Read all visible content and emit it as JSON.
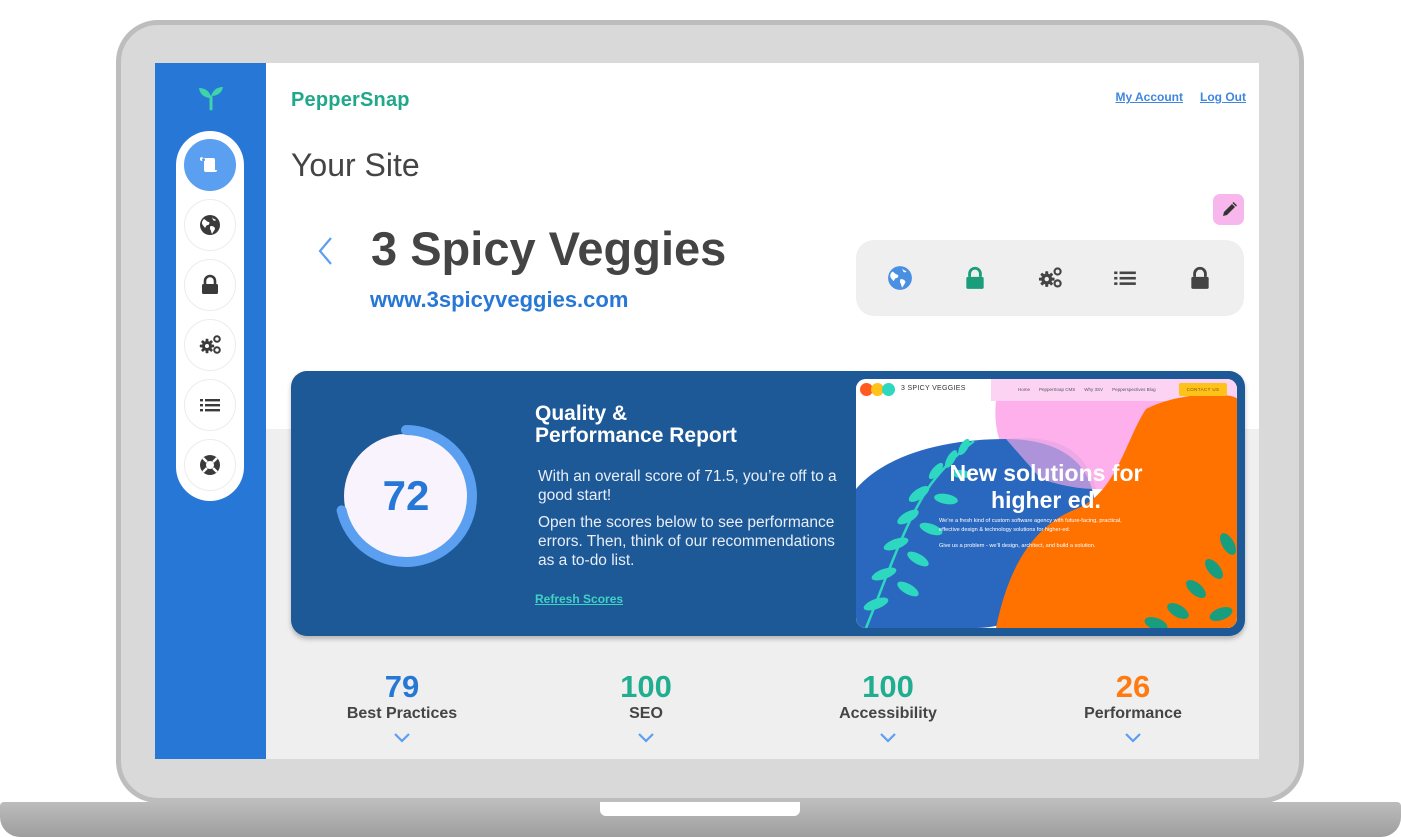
{
  "app": {
    "brand": "PepperSnap",
    "page_title": "Your Site"
  },
  "header": {
    "links": [
      {
        "label": "My Account"
      },
      {
        "label": "Log Out"
      }
    ]
  },
  "sidebar": {
    "logo_icon": "sprout-icon",
    "items": [
      {
        "name": "sites",
        "icon": "scroll-icon",
        "active": true
      },
      {
        "name": "domains",
        "icon": "globe-icon",
        "active": false
      },
      {
        "name": "security",
        "icon": "lock-icon",
        "active": false
      },
      {
        "name": "settings",
        "icon": "gears-icon",
        "active": false
      },
      {
        "name": "list",
        "icon": "list-icon",
        "active": false
      },
      {
        "name": "support",
        "icon": "lifebuoy-icon",
        "active": false
      }
    ]
  },
  "site": {
    "name": "3 Spicy Veggies",
    "url": "www.3spicyveggies.com",
    "status_icons": [
      {
        "icon": "globe-icon",
        "color": "#4a90e2"
      },
      {
        "icon": "lock-icon",
        "color": "#1a9e7a"
      },
      {
        "icon": "gears-icon",
        "color": "#444444"
      },
      {
        "icon": "list-icon",
        "color": "#444444"
      },
      {
        "icon": "lock-icon",
        "color": "#444444"
      }
    ]
  },
  "report": {
    "title_line1": "Quality &",
    "title_line2": "Performance Report",
    "score_display": "72",
    "score_value": 71.5,
    "score_max": 100,
    "paragraph1": "With an overall score of 71.5, you’re off to a good start!",
    "paragraph2": "Open the scores below to see performance errors. Then, think of our recommendations as a to-do list.",
    "refresh_label": "Refresh Scores"
  },
  "preview": {
    "brand": "3 SPICY VEGGIES",
    "nav": [
      "Home",
      "PepperSnap CMS",
      "Why 3SV",
      "Pepperspectives Blog"
    ],
    "cta": "CONTACT US",
    "headline_line1": "New solutions for",
    "headline_line2": "higher ed.",
    "body1": "We’re a fresh kind of custom software agency with future-facing, practical, effective design & technology solutions for higher-ed.",
    "body2": "Give us a problem - we’ll design, architect, and build a solution."
  },
  "scores": [
    {
      "value": "79",
      "label": "Best Practices",
      "color": "#2777d6"
    },
    {
      "value": "100",
      "label": "SEO",
      "color": "#21ad8f"
    },
    {
      "value": "100",
      "label": "Accessibility",
      "color": "#21ad8f"
    },
    {
      "value": "26",
      "label": "Performance",
      "color": "#ff7a10"
    }
  ],
  "colors": {
    "sidebar": "#2777d6",
    "brand": "#21a88a",
    "report_bg": "#1d5897",
    "gauge_arc": "#5b9ff0",
    "link": "#3f86e0"
  }
}
